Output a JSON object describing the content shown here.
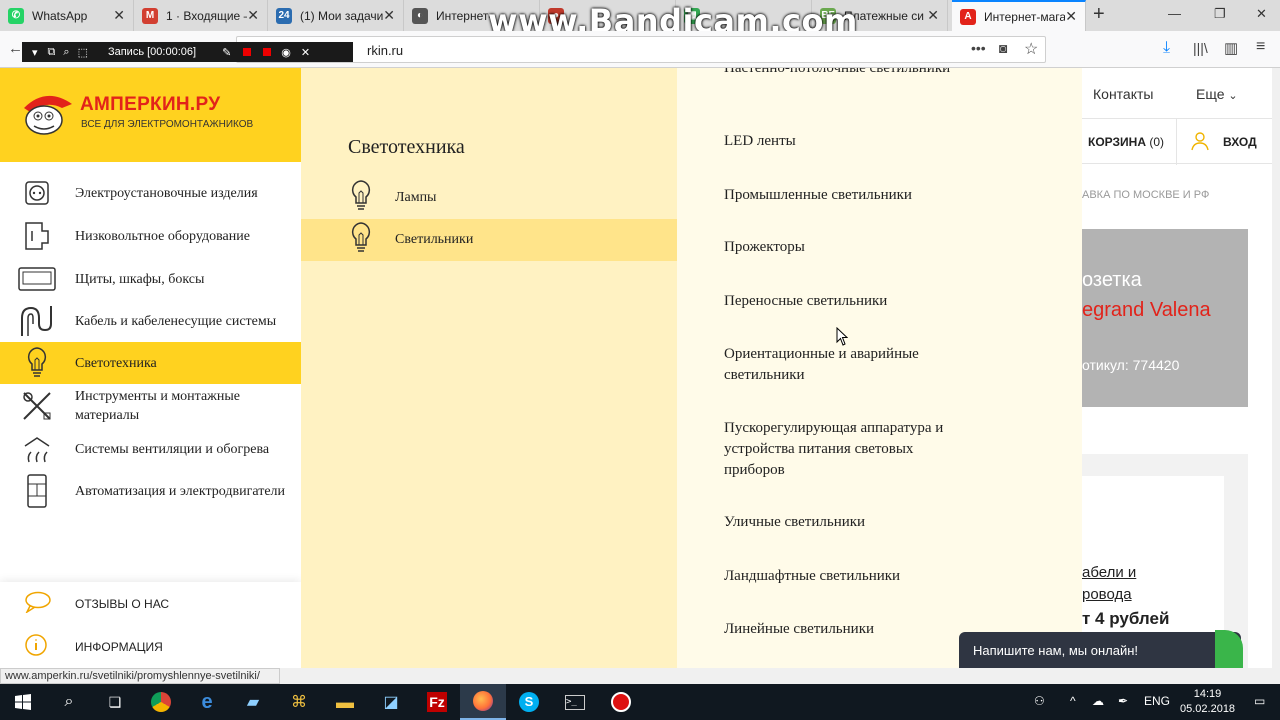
{
  "browser": {
    "tabs": [
      {
        "title": "WhatsApp",
        "color": "#25d366",
        "glyph": "✆"
      },
      {
        "title": "1 · Входящие —",
        "color": "#d23f31",
        "glyph": "M"
      },
      {
        "title": "(1) Мои задачи",
        "color": "#2b6cb0",
        "glyph": "24"
      },
      {
        "title": "Интернет-",
        "color": "#555555",
        "glyph": "◐"
      },
      {
        "title": "",
        "color": "#c0392b",
        "glyph": "●"
      },
      {
        "title": "Tried Nail Po…",
        "color": "#34a853",
        "glyph": "▦"
      },
      {
        "title": "Платежные си",
        "color": "#6aa84f",
        "glyph": "BF"
      },
      {
        "title": "Интернет-мага",
        "color": "#e2231a",
        "glyph": "A"
      }
    ],
    "url": "rkin.ru",
    "status_url": "www.amperkin.ru/svetilniki/promyshlennye-svetilniki/"
  },
  "watermark": "www.Bandicam.com",
  "recorder": {
    "label": "Запись [00:00:06]"
  },
  "site": {
    "logo_title": "АМПЕРКИН.РУ",
    "logo_subtitle": "ВСЕ ДЛЯ ЭЛЕКТРОМОНТАЖНИКОВ",
    "categories": [
      {
        "label": "Электроустановочные изделия",
        "icon": "socket-icon"
      },
      {
        "label": "Низковольтное оборудование",
        "icon": "breaker-icon"
      },
      {
        "label": "Щиты, шкафы, боксы",
        "icon": "cabinet-icon"
      },
      {
        "label": "Кабель и кабеленесущие системы",
        "icon": "cable-icon"
      },
      {
        "label": "Светотехника",
        "icon": "bulb-icon"
      },
      {
        "label": "Инструменты и монтажные материалы",
        "icon": "tools-icon"
      },
      {
        "label": "Системы вентиляции и обогрева",
        "icon": "heat-icon"
      },
      {
        "label": "Автоматизация и электродвигатели",
        "icon": "automation-icon"
      }
    ],
    "reviews_label": "ОТЗЫВЫ О НАС",
    "info_label": "ИНФОРМАЦИЯ",
    "submenu_title": "Светотехника",
    "submenu": [
      {
        "label": "Лампы"
      },
      {
        "label": "Светильники"
      }
    ],
    "list": [
      "Настенно-потолочные светильники",
      "LED ленты",
      "Промышленные светильники",
      "Прожекторы",
      "Переносные светильники",
      "Ориентационные и аварийные светильники",
      "Пускорегулирующая аппаратура и устройства питания световых приборов",
      "Уличные светильники",
      "Ландшафтные светильники",
      "Линейные светильники"
    ],
    "nav_contacts": "Контакты",
    "nav_more": "Еще",
    "cart_label": "КОРЗИНА",
    "cart_count": "(0)",
    "login_label": "ВХОД",
    "delivery": "АВКА ПО МОСКВЕ И РФ",
    "promo": {
      "line1": "озетка",
      "line2": "egrand Valena",
      "line3": "отикул: 774420"
    },
    "card": {
      "line1": "абели и",
      "line2": "ровода",
      "line3": "т 4 рублей"
    },
    "chat": "Напишите нам, мы онлайн!"
  },
  "taskbar": {
    "lang": "ENG",
    "time": "14:19",
    "date": "05.02.2018"
  },
  "colors": {
    "brand_yellow": "#ffd21f",
    "brand_red": "#e2231a",
    "submenu_bg": "#fff2c2"
  }
}
